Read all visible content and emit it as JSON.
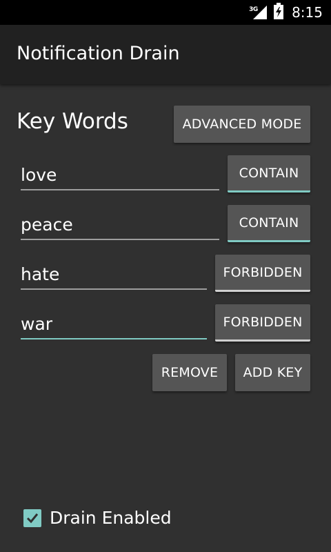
{
  "status_bar": {
    "network": "3G",
    "time": "8:15",
    "icons": [
      "signal-icon",
      "battery-icon"
    ]
  },
  "app_bar": {
    "title": "Notification Drain"
  },
  "section": {
    "title": "Key Words",
    "advanced_mode_label": "ADVANCED MODE"
  },
  "keywords": [
    {
      "value": "love",
      "mode": "CONTAIN"
    },
    {
      "value": "peace",
      "mode": "CONTAIN"
    },
    {
      "value": "hate",
      "mode": "FORBIDDEN"
    },
    {
      "value": "war",
      "mode": "FORBIDDEN"
    }
  ],
  "actions": {
    "remove_label": "REMOVE",
    "add_key_label": "ADD KEY"
  },
  "drain": {
    "label": "Drain Enabled",
    "checked": true
  },
  "colors": {
    "accent": "#80cbc4",
    "background": "#303030",
    "app_bar": "#212121",
    "button": "#555555"
  }
}
